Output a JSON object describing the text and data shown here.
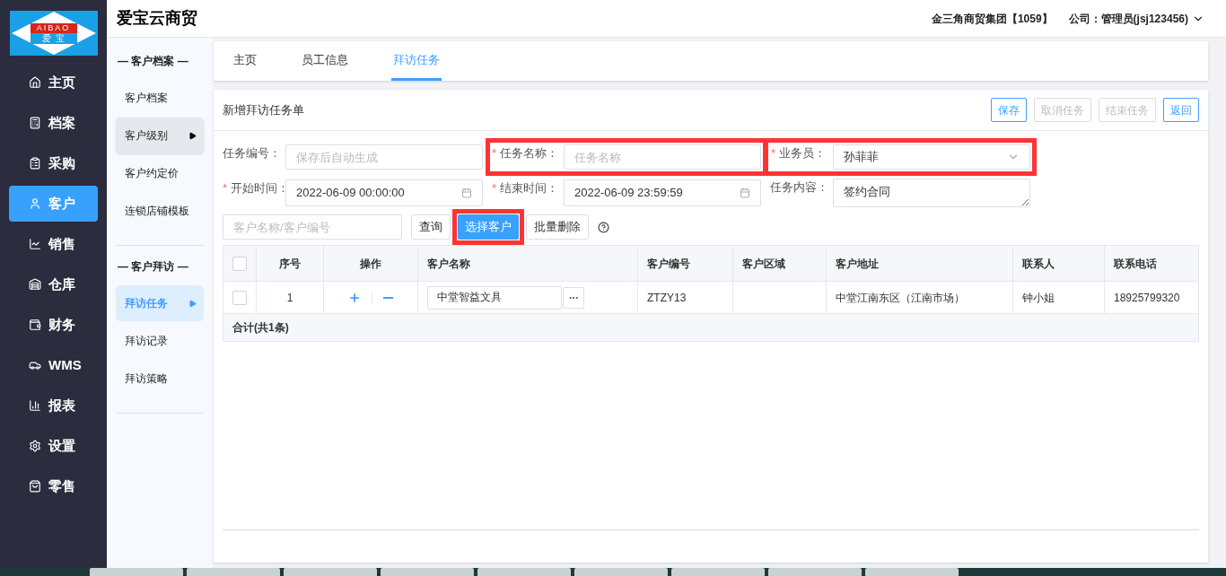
{
  "logo": {
    "top": "AIBAO",
    "bottom": "爱  宝"
  },
  "nav": [
    {
      "label": "主页",
      "selected": false
    },
    {
      "label": "档案",
      "selected": false
    },
    {
      "label": "采购",
      "selected": false
    },
    {
      "label": "客户",
      "selected": true
    },
    {
      "label": "销售",
      "selected": false
    },
    {
      "label": "仓库",
      "selected": false
    },
    {
      "label": "财务",
      "selected": false
    },
    {
      "label": "WMS",
      "selected": false
    },
    {
      "label": "报表",
      "selected": false
    },
    {
      "label": "设置",
      "selected": false
    },
    {
      "label": "零售",
      "selected": false
    }
  ],
  "header": {
    "title": "爱宝云商贸",
    "company": "金三角商贸集团【1059】",
    "user": "公司：管理员(jsj123456)"
  },
  "submenu": [
    {
      "title": "— 客户档案 —",
      "items": [
        {
          "label": "客户档案",
          "selected": false,
          "hovered": false
        },
        {
          "label": "客户级别",
          "selected": false,
          "hovered": true
        },
        {
          "label": "客户约定价",
          "selected": false,
          "hovered": false
        },
        {
          "label": "连锁店铺模板",
          "selected": false,
          "hovered": false
        }
      ]
    },
    {
      "title": "— 客户拜访 —",
      "items": [
        {
          "label": "拜访任务",
          "selected": true,
          "hovered": false
        },
        {
          "label": "拜访记录",
          "selected": false,
          "hovered": false
        },
        {
          "label": "拜访策略",
          "selected": false,
          "hovered": false
        }
      ]
    }
  ],
  "tabs": [
    {
      "label": "主页",
      "selected": false
    },
    {
      "label": "员工信息",
      "selected": false
    },
    {
      "label": "拜访任务",
      "selected": true
    }
  ],
  "form": {
    "title": "新增拜访任务单",
    "buttons": [
      {
        "label": "保存",
        "disabled": false
      },
      {
        "label": "取消任务",
        "disabled": true
      },
      {
        "label": "结束任务",
        "disabled": true
      },
      {
        "label": "返回",
        "disabled": false
      }
    ],
    "fields": [
      {
        "label": "任务编号：",
        "kind": "input",
        "placeholder": "保存后自动生成",
        "annotated": false
      },
      {
        "required_mark": "*",
        "label": "任务名称：",
        "kind": "input",
        "placeholder": "任务名称",
        "annotated": true
      },
      {
        "required_mark": "*",
        "label": "业务员：",
        "kind": "select",
        "value": "孙菲菲",
        "annotated": true
      },
      {
        "required_mark": "*",
        "label": "开始时间：",
        "kind": "date",
        "value": "2022-06-09 00:00:00",
        "annotated": false
      },
      {
        "required_mark": "*",
        "label": "结束时间：",
        "kind": "date",
        "value": "2022-06-09 23:59:59",
        "annotated": false
      },
      {
        "label": "任务内容：",
        "kind": "textarea",
        "value": "签约合同",
        "annotated": false
      }
    ]
  },
  "toolbar": {
    "search": {
      "placeholder": "客户名称/客户编号"
    },
    "buttons": [
      {
        "label": "查询",
        "primary": false,
        "annotated": false
      },
      {
        "label": "选择客户",
        "primary": true,
        "annotated": true
      },
      {
        "label": "批量删除",
        "primary": false,
        "annotated": false
      }
    ]
  },
  "table": {
    "header_checked": false,
    "columns": [
      "序号",
      "操作",
      "客户名称",
      "客户编号",
      "客户区域",
      "客户地址",
      "联系人",
      "联系电话"
    ],
    "rows": [
      {
        "checked": false,
        "cells": [
          "1",
          "",
          "中堂智益文具",
          "ZTZY13",
          "",
          "中堂江南东区（江南市场）",
          "钟小姐",
          "18925799320"
        ]
      }
    ],
    "footer": "合计(共1条)"
  }
}
